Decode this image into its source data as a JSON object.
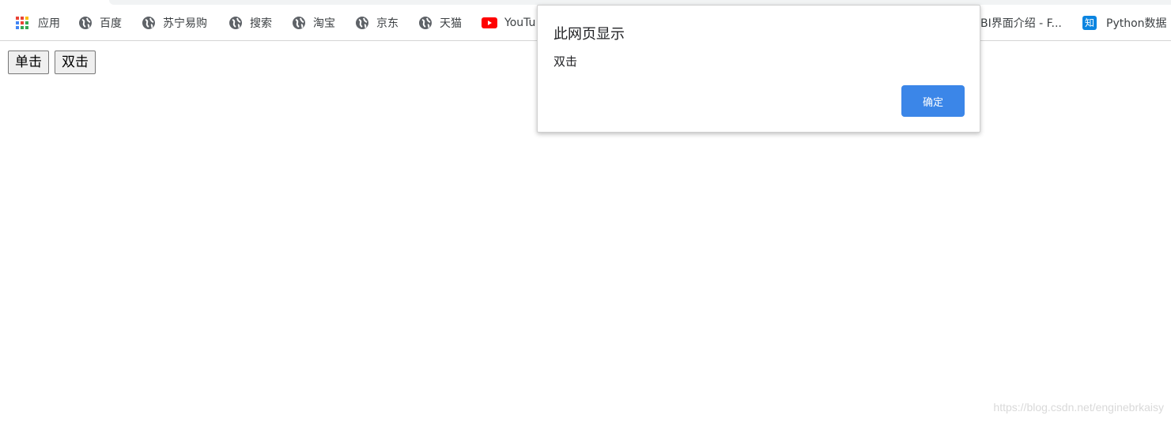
{
  "bookmarks": {
    "apps_label": "应用",
    "items": [
      {
        "label": "百度",
        "icon": "globe-icon"
      },
      {
        "label": "苏宁易购",
        "icon": "globe-icon"
      },
      {
        "label": "搜索",
        "icon": "globe-icon"
      },
      {
        "label": "淘宝",
        "icon": "globe-icon"
      },
      {
        "label": "京东",
        "icon": "globe-icon"
      },
      {
        "label": "天猫",
        "icon": "globe-icon"
      },
      {
        "label": "YouTu",
        "icon": "youtube-icon"
      }
    ],
    "right_items": [
      {
        "label": "BI界面介绍 - F...",
        "icon": ""
      },
      {
        "label": "Python数据",
        "icon": "zhihu-icon",
        "icon_text": "知"
      }
    ]
  },
  "page": {
    "single_click_label": "单击",
    "double_click_label": "双击"
  },
  "dialog": {
    "title": "此网页显示",
    "message": "双击",
    "ok_label": "确定"
  },
  "watermark": "https://blog.csdn.net/enginebrkaisy",
  "colors": {
    "dialog_button": "#3b86e8",
    "youtube_red": "#ff0000",
    "zhihu_blue": "#0a84e0"
  }
}
